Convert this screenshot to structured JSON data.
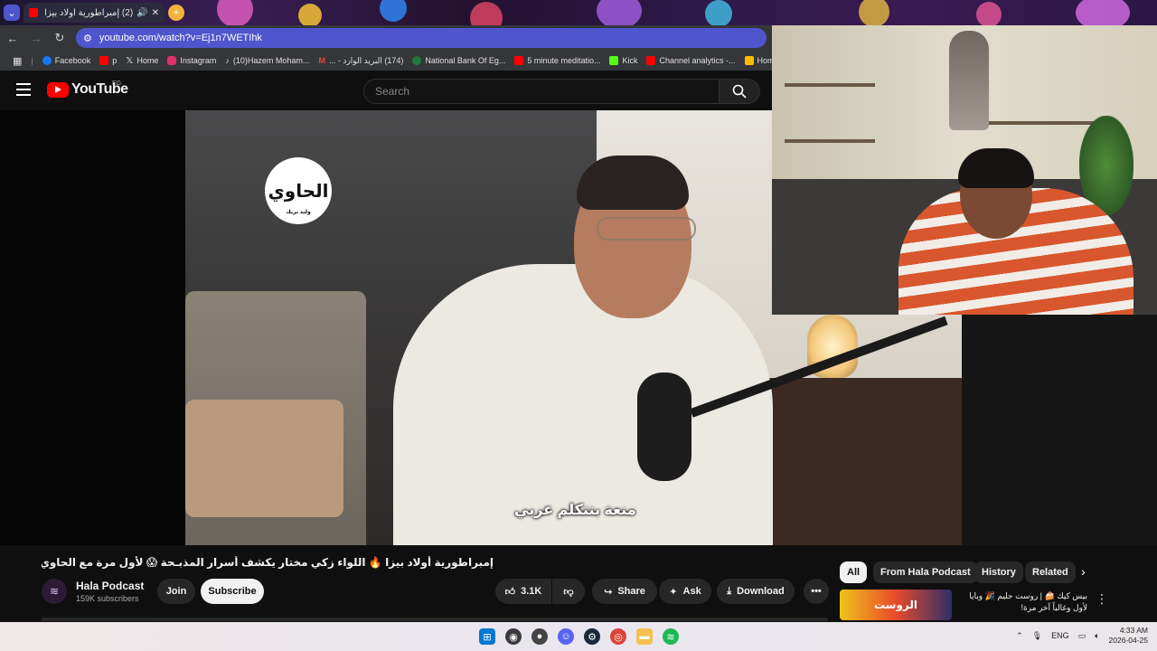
{
  "browser": {
    "tab_title": "(2) إمبراطورية أولاد بيزا",
    "url": "youtube.com/watch?v=Ej1n7WETIhk",
    "bookmarks": [
      {
        "label": "Facebook",
        "color": "#1877f2"
      },
      {
        "label": "p",
        "color": "#ff0000"
      },
      {
        "label": "Home",
        "color": "#ffffff"
      },
      {
        "label": "Instagram",
        "color": "#e1306c"
      },
      {
        "label": "(10)Hazem Moham...",
        "color": "#ffffff"
      },
      {
        "label": "(174) البريد الوارد - ...",
        "color": "#ea4335"
      },
      {
        "label": "National Bank Of Eg...",
        "color": "#1e7a3c"
      },
      {
        "label": "5 minute meditatio...",
        "color": "#ff0000"
      },
      {
        "label": "Kick",
        "color": "#53fc18"
      },
      {
        "label": "Channel analytics -...",
        "color": "#ff0000"
      },
      {
        "label": "Home -",
        "color": "#fbbc04"
      }
    ]
  },
  "youtube": {
    "logo_text": "YouTube",
    "region": "EG",
    "search_placeholder": "Search"
  },
  "video": {
    "channel_logo_text": "الحاوي",
    "channel_logo_sub": "وليد بريك",
    "subtitle": "منعة بتتكلم عربي",
    "title": "إمبراطورية أولاد بيزا 🔥 اللواء زكي مختار يكشف أسرار المذبـحة 😱 لأول مرة مع الحاوي وليد بريك"
  },
  "channel": {
    "name": "Hala Podcast",
    "subscribers": "159K subscribers",
    "join_label": "Join",
    "subscribe_label": "Subscribe"
  },
  "actions": {
    "likes": "3.1K",
    "share_label": "Share",
    "ask_label": "Ask",
    "download_label": "Download"
  },
  "chips": [
    "All",
    "From Hala Podcast",
    "History",
    "Related"
  ],
  "recommendation": {
    "thumb_text": "الروست",
    "title": "بيس كيك 🍰 | روست حليم 🎉 ويايا لأول وغالباً آخر مرة!"
  },
  "taskbar": {
    "language": "ENG",
    "time": "4:33 AM",
    "date": "2026-04-25"
  }
}
